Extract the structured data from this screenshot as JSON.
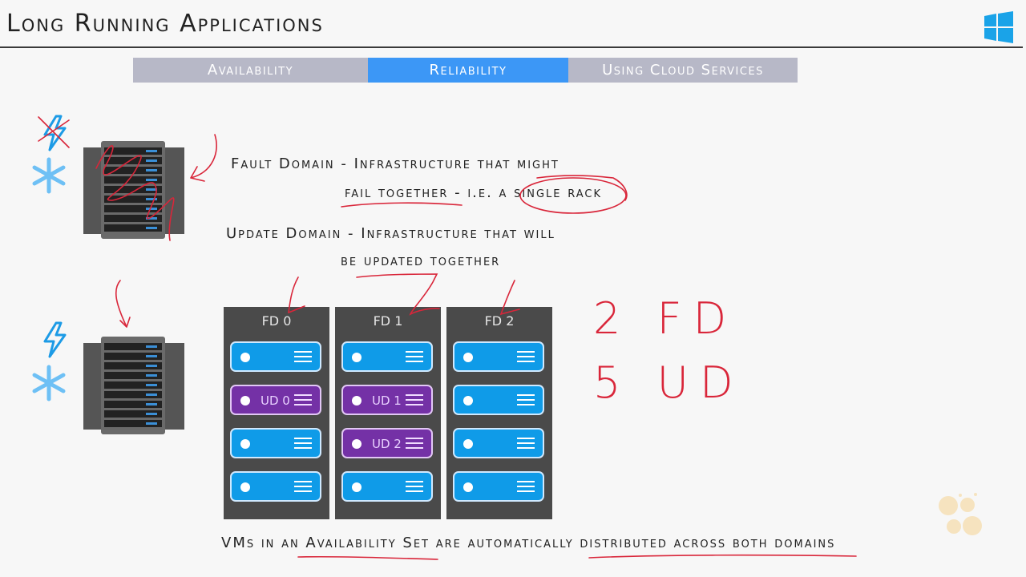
{
  "header": {
    "title": "Long Running Applications",
    "logo_icon": "windows-logo-icon"
  },
  "tabs": [
    {
      "label": "Availability",
      "active": false
    },
    {
      "label": "Reliability",
      "active": true
    },
    {
      "label": "Using Cloud Services",
      "active": false
    }
  ],
  "definitions": {
    "fault_domain_line1": "Fault Domain - Infrastructure that might",
    "fault_domain_line2": "fail together - i.e. a single rack",
    "update_domain_line1": "Update Domain - Infrastructure that will",
    "update_domain_line2": "be updated together"
  },
  "racks": [
    {
      "icons": [
        "power-icon-crossed",
        "cooling-snowflake-icon"
      ],
      "annotated": "scribbled-out"
    },
    {
      "icons": [
        "power-icon",
        "cooling-snowflake-icon"
      ],
      "annotated": "arrow"
    }
  ],
  "fault_domains": [
    {
      "label": "FD 0",
      "vms": [
        {
          "ud": null
        },
        {
          "ud": "UD 0"
        },
        {
          "ud": null
        },
        {
          "ud": null
        }
      ]
    },
    {
      "label": "FD 1",
      "vms": [
        {
          "ud": null
        },
        {
          "ud": "UD 1"
        },
        {
          "ud": "UD 2"
        },
        {
          "ud": null
        }
      ]
    },
    {
      "label": "FD 2",
      "vms": [
        {
          "ud": null
        },
        {
          "ud": null
        },
        {
          "ud": null
        },
        {
          "ud": null
        }
      ]
    }
  ],
  "handwritten_notes": {
    "fd_count": "2 FD",
    "ud_count": "5 UD"
  },
  "footer_text": "VMs in an Availability Set are automatically distributed across both domains",
  "colors": {
    "tab_active": "#3c97f6",
    "tab_inactive": "#b7b8c7",
    "vm_blue": "#0f9be8",
    "vm_purple": "#7431a6",
    "fd_column": "#4a4a4a",
    "annotation_red": "#d9263a",
    "windows_blue": "#1aa3e8"
  }
}
